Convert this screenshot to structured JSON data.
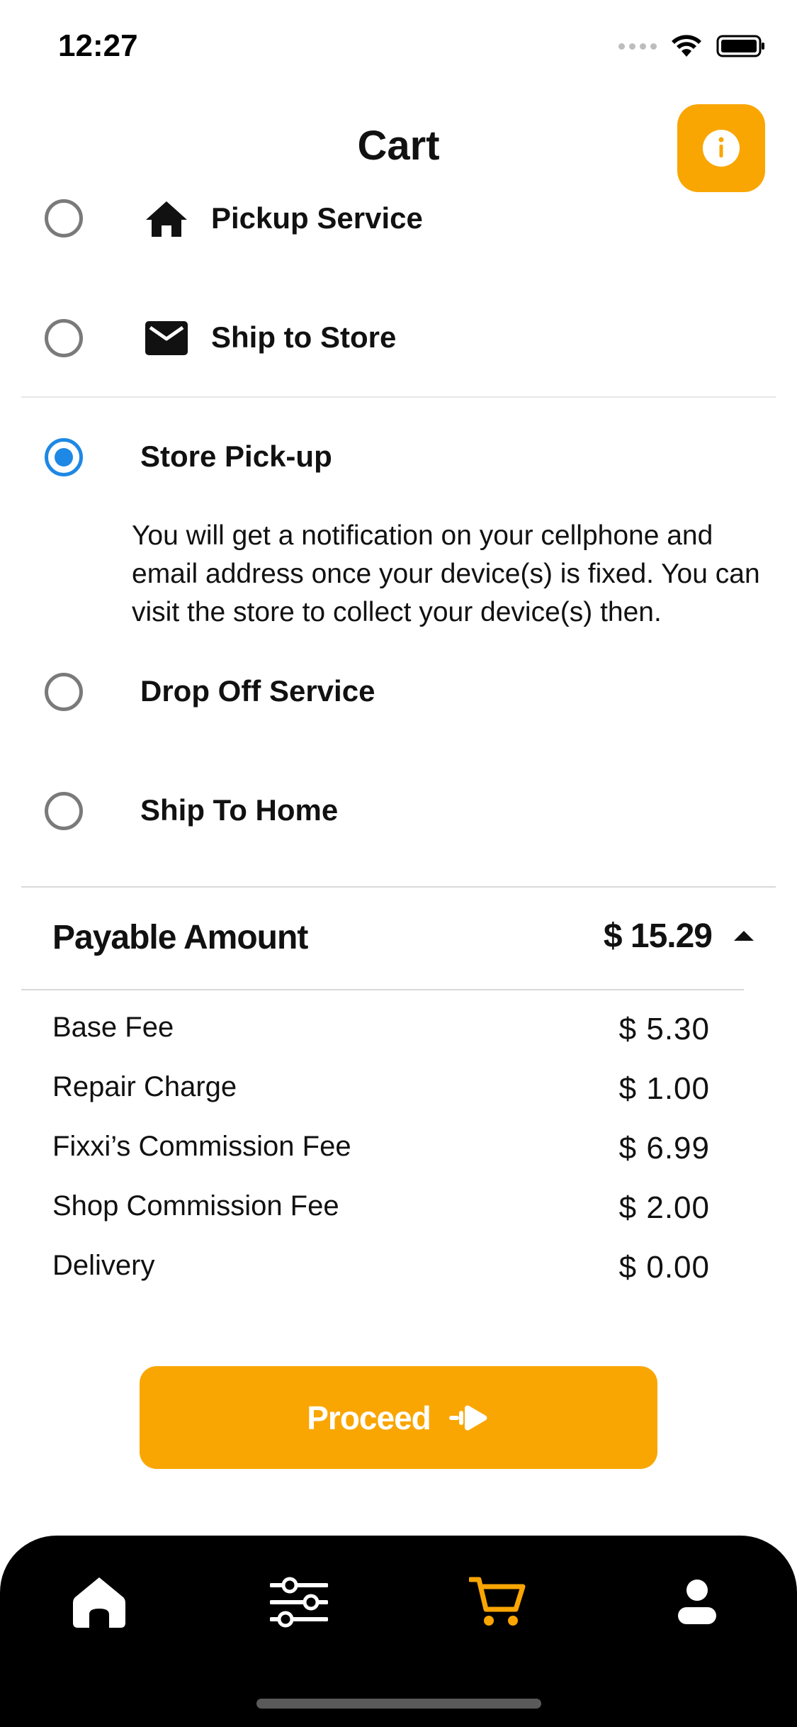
{
  "status_bar": {
    "time": "12:27"
  },
  "header": {
    "title": "Cart"
  },
  "delivery_options": [
    {
      "label": "Pickup Service",
      "icon": "home-icon",
      "selected": false
    },
    {
      "label": "Ship to Store",
      "icon": "mail-icon",
      "selected": false
    },
    {
      "label": "Store Pick-up",
      "selected": true
    },
    {
      "label": "Drop Off Service",
      "selected": false
    },
    {
      "label": "Ship To Home",
      "selected": false
    }
  ],
  "store_pickup_description": "You will get a notification on your cellphone and email address once your device(s) is fixed. You can visit the store to collect your device(s) then.",
  "payable": {
    "label": "Payable Amount",
    "amount": "$ 15.29"
  },
  "fees": [
    {
      "label": "Base Fee",
      "value": "$ 5.30"
    },
    {
      "label": "Repair Charge",
      "value": "$ 1.00"
    },
    {
      "label": "Fixxi’s Commission Fee",
      "value": "$ 6.99"
    },
    {
      "label": "Shop Commission Fee",
      "value": "$ 2.00"
    },
    {
      "label": "Delivery",
      "value": "$ 0.00"
    }
  ],
  "proceed": {
    "label": "Proceed"
  },
  "bottom_nav": [
    {
      "icon": "home-icon",
      "active": false
    },
    {
      "icon": "filters-icon",
      "active": false
    },
    {
      "icon": "cart-icon",
      "active": true
    },
    {
      "icon": "profile-icon",
      "active": false
    }
  ],
  "colors": {
    "accent": "#f9a602",
    "radio_selected": "#1e88e5",
    "nav_background": "#000000"
  }
}
